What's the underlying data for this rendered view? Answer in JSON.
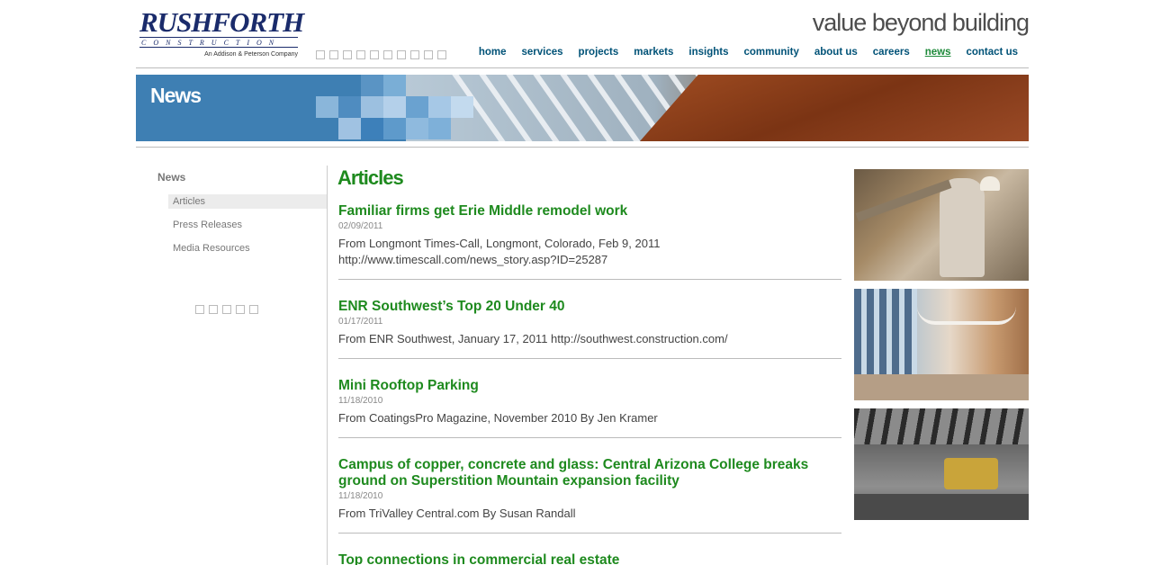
{
  "header": {
    "logo_main": "RUSHFORTH",
    "logo_sub": "CONSTRUCTION",
    "logo_tag": "An Addison & Peterson Company",
    "tagline": "value beyond building",
    "nav": [
      {
        "label": "home",
        "active": false
      },
      {
        "label": "services",
        "active": false
      },
      {
        "label": "projects",
        "active": false
      },
      {
        "label": "markets",
        "active": false
      },
      {
        "label": "insights",
        "active": false
      },
      {
        "label": "community",
        "active": false
      },
      {
        "label": "about us",
        "active": false
      },
      {
        "label": "careers",
        "active": false
      },
      {
        "label": "news",
        "active": true
      },
      {
        "label": "contact us",
        "active": false
      }
    ]
  },
  "banner": {
    "title": "News"
  },
  "sidebar": {
    "title": "News",
    "items": [
      {
        "label": "Articles",
        "active": true
      },
      {
        "label": "Press Releases",
        "active": false
      },
      {
        "label": "Media Resources",
        "active": false
      }
    ]
  },
  "main": {
    "title": "Articles",
    "articles": [
      {
        "title": "Familiar firms get Erie Middle remodel work",
        "date": "02/09/2011",
        "body": "From Longmont Times-Call, Longmont, Colorado, Feb 9, 2011 http://www.timescall.com/news_story.asp?ID=25287"
      },
      {
        "title": "ENR Southwest’s Top 20 Under 40",
        "date": "01/17/2011",
        "body": "From ENR Southwest, January 17, 2011 http://southwest.construction.com/"
      },
      {
        "title": "Mini Rooftop Parking",
        "date": "11/18/2010",
        "body": "From CoatingsPro Magazine, November 2010 By Jen Kramer"
      },
      {
        "title": "Campus of copper, concrete and glass: Central Arizona College breaks ground on Superstition Mountain expansion facility",
        "date": "11/18/2010",
        "body": "From TriValley Central.com By Susan Randall"
      },
      {
        "title": "Top connections in commercial real estate",
        "date": "",
        "body": ""
      }
    ]
  },
  "colors": {
    "nav": "#005277",
    "accent_green": "#1e8a1e",
    "banner_blue": "#3e7fb3"
  }
}
